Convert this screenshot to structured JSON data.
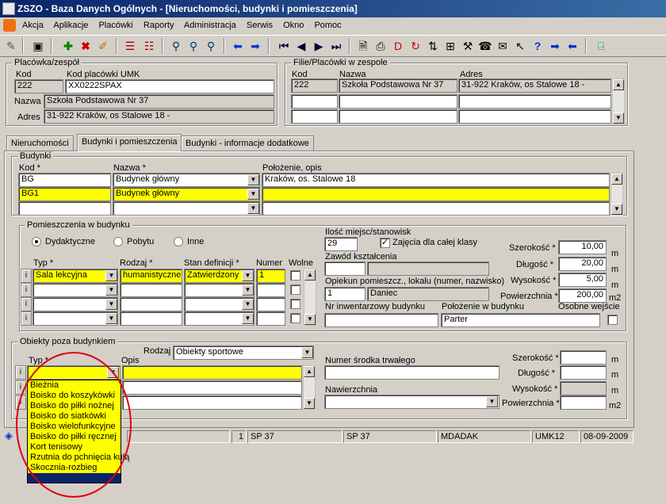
{
  "window": {
    "title": "ZSZO - Baza Danych Ogólnych - [Nieruchomości, budynki i pomieszczenia]"
  },
  "menu": [
    "Akcja",
    "Aplikacje",
    "Placówki",
    "Raporty",
    "Administracja",
    "Serwis",
    "Okno",
    "Pomoc"
  ],
  "placowka": {
    "group_title": "Placówka/zespół",
    "kod_label": "Kod",
    "kod_umk_label": "Kod placówki UMK",
    "kod": "222",
    "kod_umk": "XX0222SPAX",
    "nazwa_label": "Nazwa",
    "nazwa": "Szkoła Podstawowa Nr  37",
    "adres_label": "Adres",
    "adres": "31-922 Kraków, os Stalowe 18 -"
  },
  "filie": {
    "group_title": "Filie/Placówki w zespole",
    "headers": [
      "Kod",
      "Nazwa",
      "Adres"
    ],
    "rows": [
      [
        "222",
        "Szkoła Podstawowa Nr  37",
        "31-922 Kraków, os Stalowe 18 -"
      ]
    ]
  },
  "tabs": [
    "Nieruchomości",
    "Budynki i pomieszczenia",
    "Budynki - informacje dodatkowe"
  ],
  "budynki": {
    "group_title": "Budynki",
    "headers": [
      "Kod *",
      "Nazwa *",
      "Położenie, opis"
    ],
    "rows": [
      {
        "kod": "BG",
        "nazwa": "Budynek główny",
        "opis": "Kraków, os. Stalowe 18"
      },
      {
        "kod": "BG1",
        "nazwa": "Budynek główny",
        "opis": ""
      }
    ]
  },
  "pomieszczenia": {
    "group_title": "Pomieszczenia w budynku",
    "radios": [
      "Dydaktyczne",
      "Pobytu",
      "Inne"
    ],
    "headers": [
      "Typ *",
      "Rodzaj *",
      "Stan definicji *",
      "Numer",
      "Wolne"
    ],
    "row": {
      "typ": "Sala lekcyjna",
      "rodzaj": "humanistyczne",
      "stan": "Zatwierdzony",
      "numer": "1"
    },
    "ilosc_label": "Ilość miejsc/stanowisk",
    "ilosc": "29",
    "zajecia_label": "Zajęcia dla całej klasy",
    "zawod_label": "Zawód kształcenia",
    "opiekun_label": "Opiekun pomieszcz., lokalu (numer, nazwisko)",
    "opiekun_nr": "1",
    "opiekun_nazwisko": "Daniec",
    "nr_inw_label": "Nr inwentarzowy budynku",
    "polozenie_label": "Położenie w budynku",
    "polozenie": "Parter",
    "osobne_label": "Osobne wejście",
    "szerokosc_label": "Szerokość *",
    "szerokosc": "10,00",
    "dlugosc_label": "Długość *",
    "dlugosc": "20,00",
    "wysokosc_label": "Wysokość *",
    "wysokosc": "5,00",
    "powierzchnia_label": "Powierzchnia *",
    "powierzchnia": "200,00",
    "unit_m": "m",
    "unit_m2": "m2"
  },
  "obiekty": {
    "group_title": "Obiekty poza budynkiem",
    "rodzaj_label": "Rodzaj",
    "rodzaj": "Obiekty sportowe",
    "typ_label": "Typ *",
    "opis_label": "Opis",
    "numer_label": "Numer środka trwałego",
    "nawierzchnia_label": "Nawierzchnia",
    "szerokosc_label": "Szerokość *",
    "dlugosc_label": "Długość *",
    "wysokosc_label": "Wysokość *",
    "powierzchnia_label": "Powierzchnia *",
    "dropdown": [
      "Bieżnia",
      "Boisko do koszykówki",
      "Boisko do piłki nożnej",
      "Boisko do siatkówki",
      "Boisko wielofunkcyjne",
      "Boisko do piłki ręcznej",
      "Kort tenisowy",
      "Rzutnia do pchnięcia kulą",
      "Skocznia-rozbieg"
    ]
  },
  "status": {
    "count": "1",
    "c1": "SP 37",
    "c2": "SP 37",
    "user": "MDADAK",
    "umk": "UMK12",
    "date": "08-09-2009"
  },
  "colors": {
    "titlebar": "#0a246a",
    "highlight": "#ffff00",
    "annotation": "#e00010"
  }
}
